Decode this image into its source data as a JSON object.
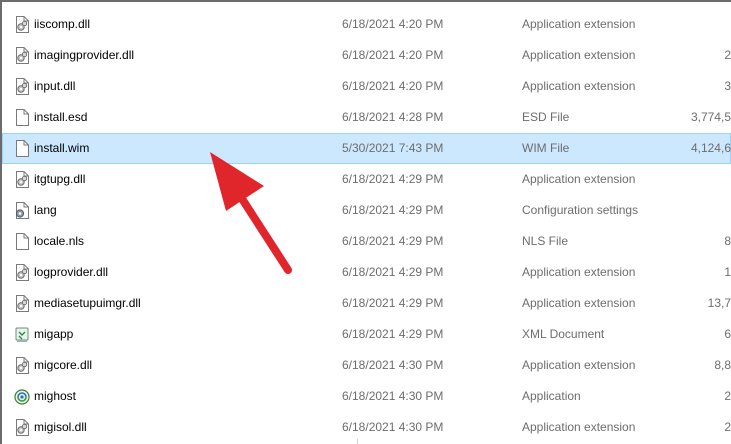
{
  "files": [
    {
      "name": "iiscomp.dll",
      "date": "6/18/2021 4:20 PM",
      "type": "Application extension",
      "size": "",
      "icon": "dll-file-icon"
    },
    {
      "name": "imagingprovider.dll",
      "date": "6/18/2021 4:20 PM",
      "type": "Application extension",
      "size": "2",
      "icon": "dll-file-icon"
    },
    {
      "name": "input.dll",
      "date": "6/18/2021 4:20 PM",
      "type": "Application extension",
      "size": "3",
      "icon": "dll-file-icon"
    },
    {
      "name": "install.esd",
      "date": "6/18/2021 4:28 PM",
      "type": "ESD File",
      "size": "3,774,5",
      "icon": "blank-file-icon"
    },
    {
      "name": "install.wim",
      "date": "5/30/2021 7:43 PM",
      "type": "WIM File",
      "size": "4,124,6",
      "icon": "blank-file-icon",
      "selected": true
    },
    {
      "name": "itgtupg.dll",
      "date": "6/18/2021 4:29 PM",
      "type": "Application extension",
      "size": "",
      "icon": "dll-file-icon"
    },
    {
      "name": "lang",
      "date": "6/18/2021 4:29 PM",
      "type": "Configuration settings",
      "size": "",
      "icon": "settings-file-icon"
    },
    {
      "name": "locale.nls",
      "date": "6/18/2021 4:29 PM",
      "type": "NLS File",
      "size": "8",
      "icon": "blank-file-icon"
    },
    {
      "name": "logprovider.dll",
      "date": "6/18/2021 4:29 PM",
      "type": "Application extension",
      "size": "1",
      "icon": "dll-file-icon"
    },
    {
      "name": "mediasetupuimgr.dll",
      "date": "6/18/2021 4:29 PM",
      "type": "Application extension",
      "size": "13,7",
      "icon": "dll-file-icon"
    },
    {
      "name": "migapp",
      "date": "6/18/2021 4:29 PM",
      "type": "XML Document",
      "size": "6",
      "icon": "xml-file-icon"
    },
    {
      "name": "migcore.dll",
      "date": "6/18/2021 4:30 PM",
      "type": "Application extension",
      "size": "8,8",
      "icon": "dll-file-icon"
    },
    {
      "name": "mighost",
      "date": "6/18/2021 4:30 PM",
      "type": "Application",
      "size": "2",
      "icon": "application-icon"
    },
    {
      "name": "migisol.dll",
      "date": "6/18/2021 4:30 PM",
      "type": "Application extension",
      "size": "2",
      "icon": "dll-file-icon"
    }
  ],
  "colors": {
    "selection_fill": "#cce8ff",
    "selection_border": "#99d1ff",
    "secondary_text": "#6d6d6d",
    "arrow": "#e0252b"
  }
}
